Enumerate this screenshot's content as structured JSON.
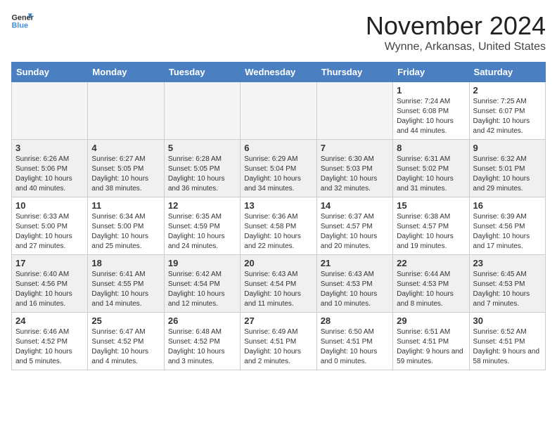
{
  "logo": {
    "line1": "General",
    "line2": "Blue"
  },
  "title": "November 2024",
  "location": "Wynne, Arkansas, United States",
  "weekdays": [
    "Sunday",
    "Monday",
    "Tuesday",
    "Wednesday",
    "Thursday",
    "Friday",
    "Saturday"
  ],
  "weeks": [
    [
      {
        "day": "",
        "sunrise": "",
        "sunset": "",
        "daylight": ""
      },
      {
        "day": "",
        "sunrise": "",
        "sunset": "",
        "daylight": ""
      },
      {
        "day": "",
        "sunrise": "",
        "sunset": "",
        "daylight": ""
      },
      {
        "day": "",
        "sunrise": "",
        "sunset": "",
        "daylight": ""
      },
      {
        "day": "",
        "sunrise": "",
        "sunset": "",
        "daylight": ""
      },
      {
        "day": "1",
        "sunrise": "Sunrise: 7:24 AM",
        "sunset": "Sunset: 6:08 PM",
        "daylight": "Daylight: 10 hours and 44 minutes."
      },
      {
        "day": "2",
        "sunrise": "Sunrise: 7:25 AM",
        "sunset": "Sunset: 6:07 PM",
        "daylight": "Daylight: 10 hours and 42 minutes."
      }
    ],
    [
      {
        "day": "3",
        "sunrise": "Sunrise: 6:26 AM",
        "sunset": "Sunset: 5:06 PM",
        "daylight": "Daylight: 10 hours and 40 minutes."
      },
      {
        "day": "4",
        "sunrise": "Sunrise: 6:27 AM",
        "sunset": "Sunset: 5:05 PM",
        "daylight": "Daylight: 10 hours and 38 minutes."
      },
      {
        "day": "5",
        "sunrise": "Sunrise: 6:28 AM",
        "sunset": "Sunset: 5:05 PM",
        "daylight": "Daylight: 10 hours and 36 minutes."
      },
      {
        "day": "6",
        "sunrise": "Sunrise: 6:29 AM",
        "sunset": "Sunset: 5:04 PM",
        "daylight": "Daylight: 10 hours and 34 minutes."
      },
      {
        "day": "7",
        "sunrise": "Sunrise: 6:30 AM",
        "sunset": "Sunset: 5:03 PM",
        "daylight": "Daylight: 10 hours and 32 minutes."
      },
      {
        "day": "8",
        "sunrise": "Sunrise: 6:31 AM",
        "sunset": "Sunset: 5:02 PM",
        "daylight": "Daylight: 10 hours and 31 minutes."
      },
      {
        "day": "9",
        "sunrise": "Sunrise: 6:32 AM",
        "sunset": "Sunset: 5:01 PM",
        "daylight": "Daylight: 10 hours and 29 minutes."
      }
    ],
    [
      {
        "day": "10",
        "sunrise": "Sunrise: 6:33 AM",
        "sunset": "Sunset: 5:00 PM",
        "daylight": "Daylight: 10 hours and 27 minutes."
      },
      {
        "day": "11",
        "sunrise": "Sunrise: 6:34 AM",
        "sunset": "Sunset: 5:00 PM",
        "daylight": "Daylight: 10 hours and 25 minutes."
      },
      {
        "day": "12",
        "sunrise": "Sunrise: 6:35 AM",
        "sunset": "Sunset: 4:59 PM",
        "daylight": "Daylight: 10 hours and 24 minutes."
      },
      {
        "day": "13",
        "sunrise": "Sunrise: 6:36 AM",
        "sunset": "Sunset: 4:58 PM",
        "daylight": "Daylight: 10 hours and 22 minutes."
      },
      {
        "day": "14",
        "sunrise": "Sunrise: 6:37 AM",
        "sunset": "Sunset: 4:57 PM",
        "daylight": "Daylight: 10 hours and 20 minutes."
      },
      {
        "day": "15",
        "sunrise": "Sunrise: 6:38 AM",
        "sunset": "Sunset: 4:57 PM",
        "daylight": "Daylight: 10 hours and 19 minutes."
      },
      {
        "day": "16",
        "sunrise": "Sunrise: 6:39 AM",
        "sunset": "Sunset: 4:56 PM",
        "daylight": "Daylight: 10 hours and 17 minutes."
      }
    ],
    [
      {
        "day": "17",
        "sunrise": "Sunrise: 6:40 AM",
        "sunset": "Sunset: 4:56 PM",
        "daylight": "Daylight: 10 hours and 16 minutes."
      },
      {
        "day": "18",
        "sunrise": "Sunrise: 6:41 AM",
        "sunset": "Sunset: 4:55 PM",
        "daylight": "Daylight: 10 hours and 14 minutes."
      },
      {
        "day": "19",
        "sunrise": "Sunrise: 6:42 AM",
        "sunset": "Sunset: 4:54 PM",
        "daylight": "Daylight: 10 hours and 12 minutes."
      },
      {
        "day": "20",
        "sunrise": "Sunrise: 6:43 AM",
        "sunset": "Sunset: 4:54 PM",
        "daylight": "Daylight: 10 hours and 11 minutes."
      },
      {
        "day": "21",
        "sunrise": "Sunrise: 6:43 AM",
        "sunset": "Sunset: 4:53 PM",
        "daylight": "Daylight: 10 hours and 10 minutes."
      },
      {
        "day": "22",
        "sunrise": "Sunrise: 6:44 AM",
        "sunset": "Sunset: 4:53 PM",
        "daylight": "Daylight: 10 hours and 8 minutes."
      },
      {
        "day": "23",
        "sunrise": "Sunrise: 6:45 AM",
        "sunset": "Sunset: 4:53 PM",
        "daylight": "Daylight: 10 hours and 7 minutes."
      }
    ],
    [
      {
        "day": "24",
        "sunrise": "Sunrise: 6:46 AM",
        "sunset": "Sunset: 4:52 PM",
        "daylight": "Daylight: 10 hours and 5 minutes."
      },
      {
        "day": "25",
        "sunrise": "Sunrise: 6:47 AM",
        "sunset": "Sunset: 4:52 PM",
        "daylight": "Daylight: 10 hours and 4 minutes."
      },
      {
        "day": "26",
        "sunrise": "Sunrise: 6:48 AM",
        "sunset": "Sunset: 4:52 PM",
        "daylight": "Daylight: 10 hours and 3 minutes."
      },
      {
        "day": "27",
        "sunrise": "Sunrise: 6:49 AM",
        "sunset": "Sunset: 4:51 PM",
        "daylight": "Daylight: 10 hours and 2 minutes."
      },
      {
        "day": "28",
        "sunrise": "Sunrise: 6:50 AM",
        "sunset": "Sunset: 4:51 PM",
        "daylight": "Daylight: 10 hours and 0 minutes."
      },
      {
        "day": "29",
        "sunrise": "Sunrise: 6:51 AM",
        "sunset": "Sunset: 4:51 PM",
        "daylight": "Daylight: 9 hours and 59 minutes."
      },
      {
        "day": "30",
        "sunrise": "Sunrise: 6:52 AM",
        "sunset": "Sunset: 4:51 PM",
        "daylight": "Daylight: 9 hours and 58 minutes."
      }
    ]
  ]
}
